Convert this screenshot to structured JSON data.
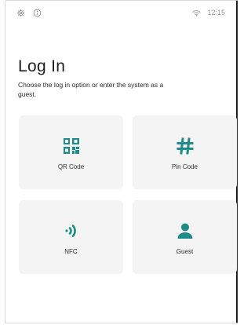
{
  "status_bar": {
    "time": "12:15",
    "icons": [
      "gear-icon",
      "info-icon",
      "wifi-icon"
    ]
  },
  "login": {
    "title": "Log In",
    "subtitle": "Choose the log in option or enter the system as a guest.",
    "accent_color": "#1e8a8a",
    "options": [
      {
        "label": "QR Code",
        "icon": "qr-code-icon"
      },
      {
        "label": "Pin Code",
        "icon": "hash-icon"
      },
      {
        "label": "NFC",
        "icon": "nfc-icon"
      },
      {
        "label": "Guest",
        "icon": "user-icon"
      }
    ]
  }
}
